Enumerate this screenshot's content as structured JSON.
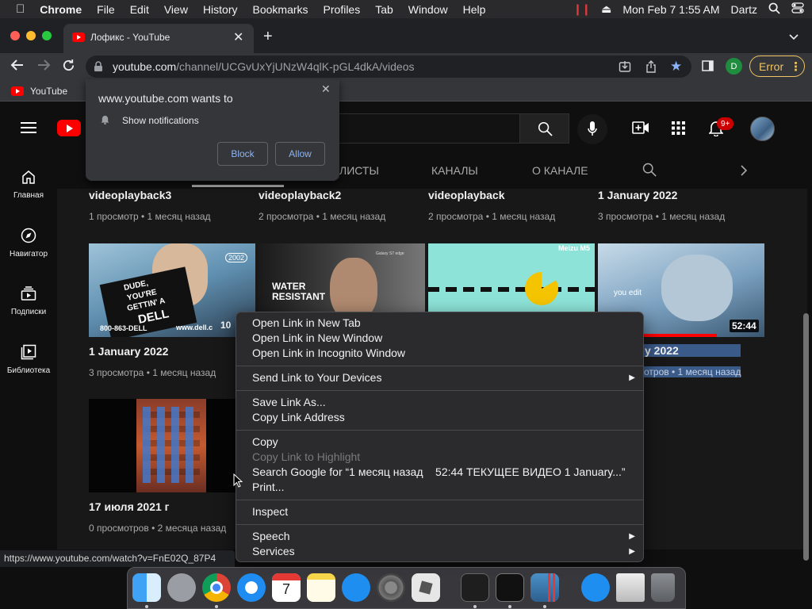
{
  "menubar": {
    "app": "Chrome",
    "items": [
      "File",
      "Edit",
      "View",
      "History",
      "Bookmarks",
      "Profiles",
      "Tab",
      "Window",
      "Help"
    ],
    "datetime": "Mon Feb 7  1:55 AM",
    "user": "Dartz"
  },
  "browser": {
    "tab_title": "Лофикс - YouTube",
    "url_host": "youtube.com",
    "url_path": "/channel/UCGvUxYjUNzW4qlK-pGL4dkA/videos",
    "profile_initial": "D",
    "error_label": "Error",
    "bookmark": "YouTube"
  },
  "notification": {
    "title": "www.youtube.com wants to",
    "message": "Show notifications",
    "block": "Block",
    "allow": "Allow"
  },
  "youtube": {
    "notif_badge": "9+",
    "sidebar": [
      {
        "label": "Главная",
        "icon": "home-icon"
      },
      {
        "label": "Навигатор",
        "icon": "compass-icon"
      },
      {
        "label": "Подписки",
        "icon": "subscriptions-icon"
      },
      {
        "label": "Библиотека",
        "icon": "library-icon"
      }
    ],
    "tabs": [
      "ЛИСТЫ",
      "КАНАЛЫ",
      "О КАНАЛЕ"
    ],
    "row1": [
      {
        "title": "videoplayback3",
        "meta": "1 просмотр • 1 месяц назад"
      },
      {
        "title": "videoplayback2",
        "meta": "2 просмотра • 1 месяц назад"
      },
      {
        "title": "videoplayback",
        "meta": "2 просмотра • 1 месяц назад"
      },
      {
        "title": "1 January 2022",
        "meta": "3 просмотра • 1 месяц назад"
      }
    ],
    "row2": [
      {
        "title": "1 January 2022",
        "meta": "3 просмотра • 1 месяц назад",
        "duration": "10"
      },
      {
        "title": "",
        "meta": "",
        "duration": ""
      },
      {
        "title": "",
        "meta": "",
        "duration": ""
      },
      {
        "title": "y 2022",
        "meta": "отров • 1 месяц назад",
        "duration": "52:44"
      }
    ],
    "row3": [
      {
        "title": "17 июля 2021 г",
        "meta": "0 просмотров • 2 месяца назад"
      }
    ],
    "thumb_text": {
      "dell_line1": "DUDE,",
      "dell_line2": "YOU'RE",
      "dell_line3": "GETTIN' A",
      "dell_brand": "DELL",
      "dell_phone": "800-863-DELL",
      "dell_web": "www.dell.c",
      "dell_year": "2002",
      "water1": "WATER",
      "water2": "RESISTANT",
      "meizu": "Meizu M5",
      "youedit": "you edit",
      "galaxy": "Galaxy S7 edge"
    }
  },
  "context_menu": {
    "group1": [
      "Open Link in New Tab",
      "Open Link in New Window",
      "Open Link in Incognito Window"
    ],
    "group2": [
      "Send Link to Your Devices"
    ],
    "group3": [
      "Save Link As...",
      "Copy Link Address"
    ],
    "group4": [
      "Copy",
      "Copy Link to Highlight",
      "Search Google for “1 месяц назад    52:44 ТЕКУЩЕЕ ВИДЕО 1 January...”",
      "Print..."
    ],
    "group5": [
      "Inspect"
    ],
    "group6": [
      "Speech",
      "Services"
    ]
  },
  "status_url": "https://www.youtube.com/watch?v=FnE02Q_87P4",
  "colors": {
    "yt_red": "#ff0000",
    "accent_blue": "#8ab4f8",
    "error_yellow": "#f0c463",
    "highlight": "#3a5a8a"
  }
}
